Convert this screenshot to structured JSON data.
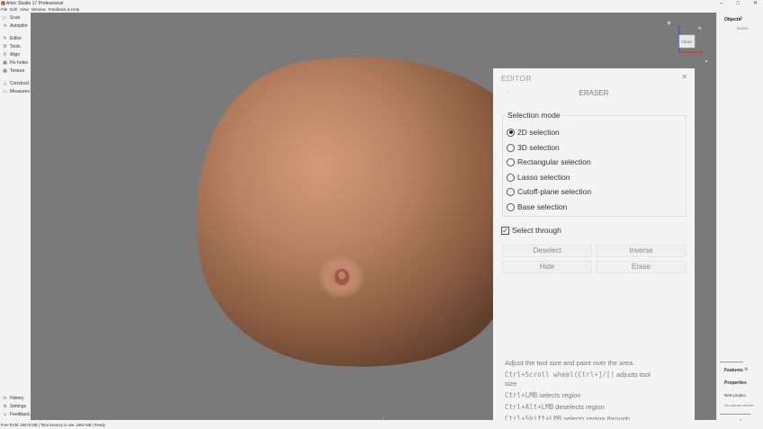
{
  "window": {
    "title": "Artec Studio 17 Professional",
    "controls": [
      "–",
      "□",
      "✕"
    ]
  },
  "menu": [
    "File",
    "Edit",
    "View",
    "Window",
    "Feedback & Help"
  ],
  "sidebar": {
    "items": [
      {
        "icon": "scan-icon",
        "label": "Scan"
      },
      {
        "icon": "autopilot-icon",
        "label": "Autopilot"
      },
      {
        "icon": "editor-icon",
        "label": "Editor"
      },
      {
        "icon": "tools-icon",
        "label": "Tools"
      },
      {
        "icon": "align-icon",
        "label": "Align"
      },
      {
        "icon": "fix-holes-icon",
        "label": "Fix holes"
      },
      {
        "icon": "texture-icon",
        "label": "Texture"
      },
      {
        "icon": "construct-icon",
        "label": "Construct"
      },
      {
        "icon": "measures-icon",
        "label": "Measures"
      }
    ],
    "bottom": [
      {
        "icon": "history-icon",
        "label": "History"
      },
      {
        "icon": "settings-icon",
        "label": "Settings"
      },
      {
        "icon": "feedback-icon",
        "label": "Feedback"
      }
    ]
  },
  "status": {
    "text": "Free RAM: 28478 MB  |  Total memory in use: 1862 MB  |  Ready"
  },
  "gizmo": {
    "face_label": "FRONT",
    "axes": [
      "Z",
      "X"
    ]
  },
  "editor": {
    "header": "EDITOR",
    "subtitle": "ERASER",
    "selection_mode_label": "Selection mode",
    "modes": [
      {
        "label": "2D selection",
        "selected": true
      },
      {
        "label": "3D selection",
        "selected": false
      },
      {
        "label": "Rectangular selection",
        "selected": false
      },
      {
        "label": "Lasso selection",
        "selected": false
      },
      {
        "label": "Cutoff-plane selection",
        "selected": false
      },
      {
        "label": "Base selection",
        "selected": false
      }
    ],
    "select_through": {
      "label": "Select through",
      "checked": true
    },
    "buttons": {
      "deselect": "Deselect",
      "inverse": "Inverse",
      "hide": "Hide",
      "erase": "Erase"
    },
    "help": {
      "line1": "Adjust the tool size and paint over the area.",
      "line2_mono": "Ctrl+Scroll wheel(Ctrl+]/[)",
      "line2_rest": " adjusts tool",
      "line2_cont": "size",
      "line3_mono": "Ctrl+LMB",
      "line3_rest": " selects region",
      "line4_mono": "Ctrl+Alt+LMB",
      "line4_rest": " deselects region",
      "line5_mono": "Ctrl+Shift+LMB",
      "line5_rest": " selects region through"
    }
  },
  "right_panel": {
    "objects_title": "Objects",
    "name_column": "Name",
    "features_title": "Features",
    "properties_title": "Properties",
    "new_project": "New project",
    "no_objects": "No objects selecte"
  }
}
